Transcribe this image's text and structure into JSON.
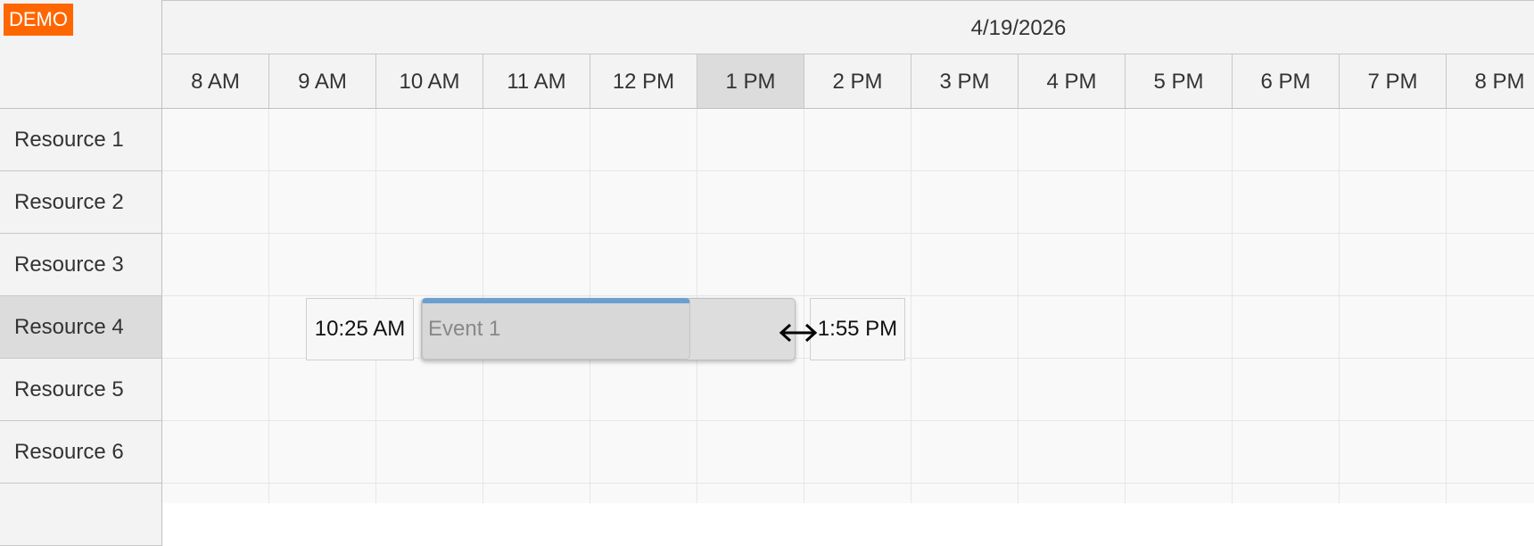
{
  "badge": "DEMO",
  "date": "4/19/2026",
  "hours": [
    "8 AM",
    "9 AM",
    "10 AM",
    "11 AM",
    "12 PM",
    "1 PM",
    "2 PM",
    "3 PM",
    "4 PM",
    "5 PM",
    "6 PM",
    "7 PM",
    "8 PM"
  ],
  "highlighted_hour": "1 PM",
  "resources": [
    "Resource 1",
    "Resource 2",
    "Resource 3",
    "Resource 4",
    "Resource 5",
    "Resource 6"
  ],
  "highlighted_resource": "Resource 4",
  "event": {
    "text": "Event 1",
    "start_label": "10:25 AM",
    "end_label": "1:55 PM",
    "bar_color": "#6b9fcf"
  },
  "colors": {
    "badge": "#ff6600",
    "header_bg": "#f3f3f3",
    "highlight_bg": "#dcdcdc"
  },
  "icons": {
    "resize": "resize-horizontal-icon"
  }
}
